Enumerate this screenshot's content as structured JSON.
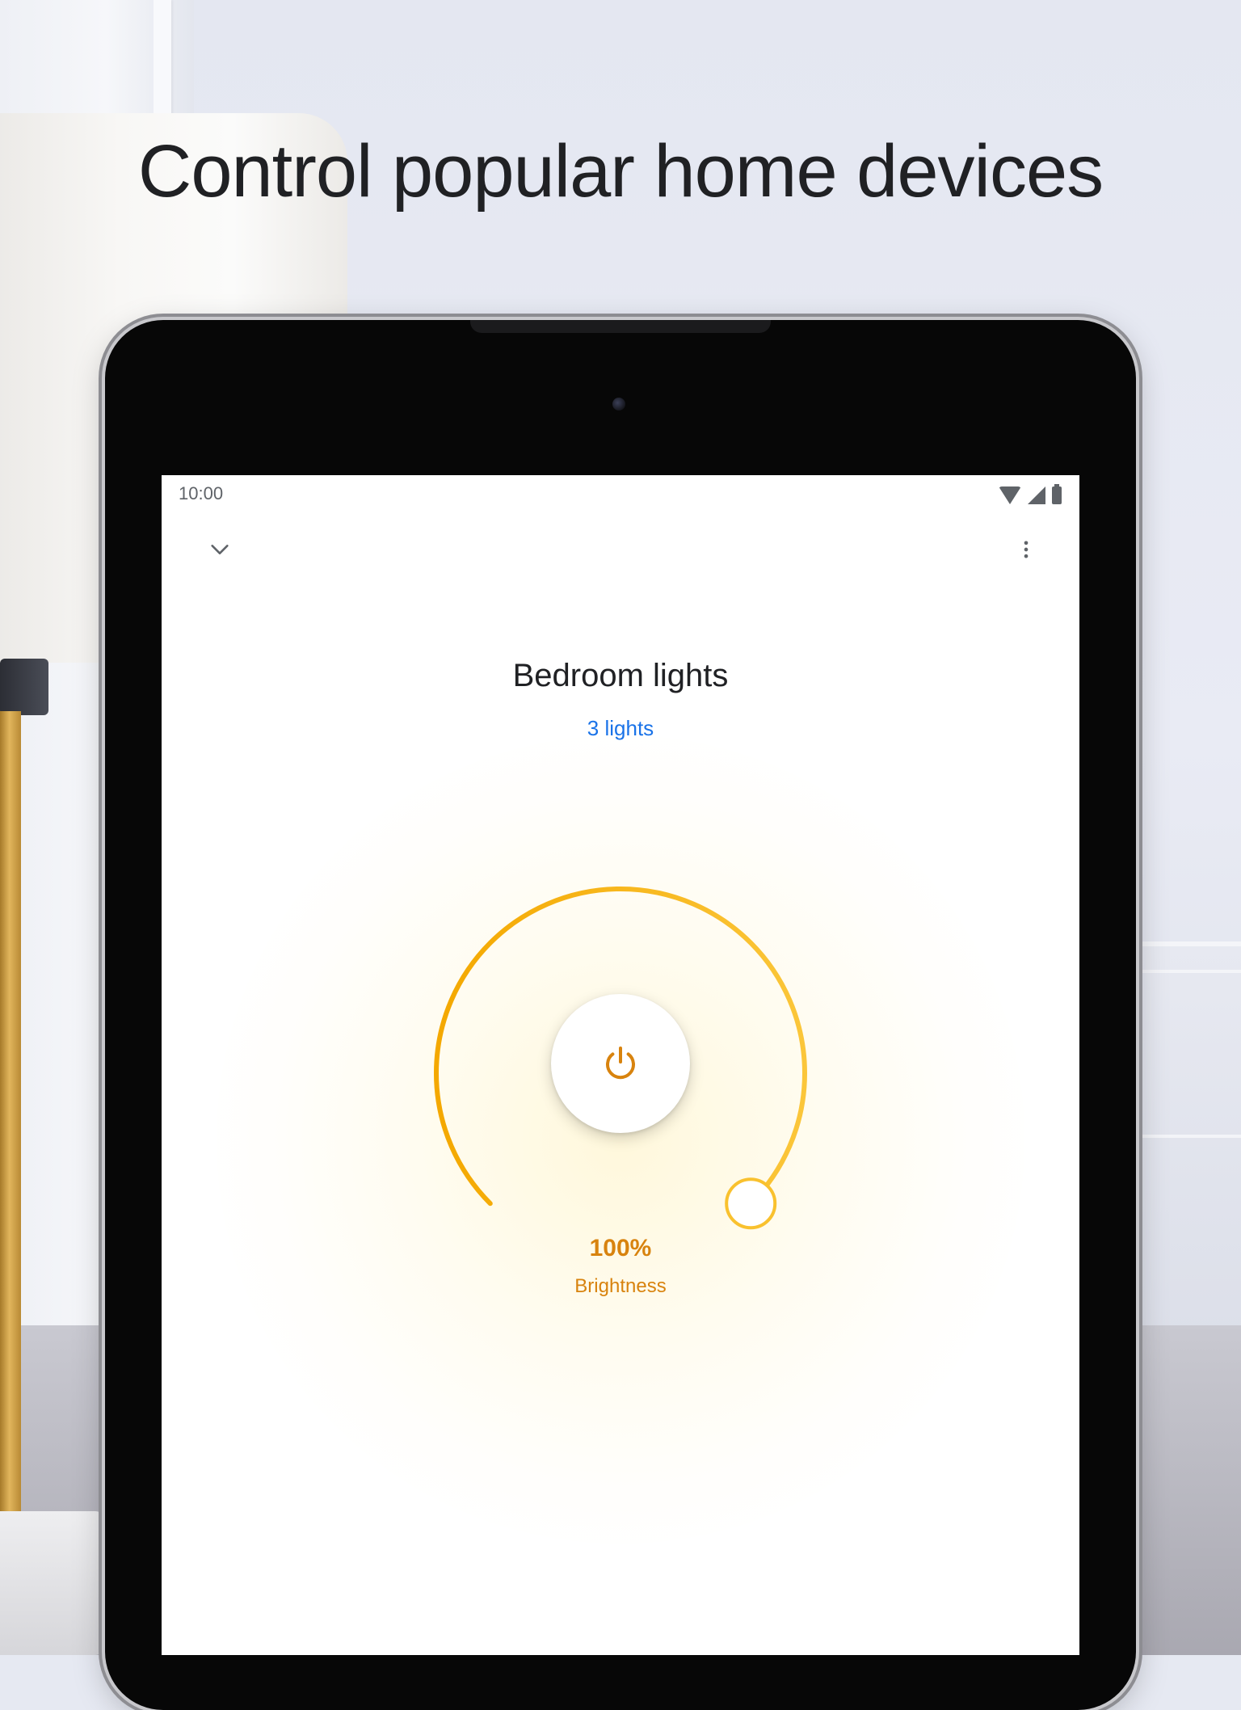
{
  "headline": "Control popular home devices",
  "status_bar": {
    "time": "10:00",
    "icons": [
      "wifi-icon",
      "signal-icon",
      "battery-icon"
    ]
  },
  "top_bar": {
    "back_icon": "chevron-down-icon",
    "menu_icon": "more-vert-icon"
  },
  "device": {
    "title": "Bedroom lights",
    "subtitle": "3 lights"
  },
  "brightness": {
    "value": "100%",
    "label": "Brightness",
    "level_fraction": 1.0
  },
  "power_icon": "power-icon",
  "colors": {
    "accent_orange": "#d8830e",
    "arc_yellow": "#f9b400",
    "link_blue": "#1a73e8",
    "text_dark": "#202124",
    "icon_gray": "#5f6368"
  }
}
